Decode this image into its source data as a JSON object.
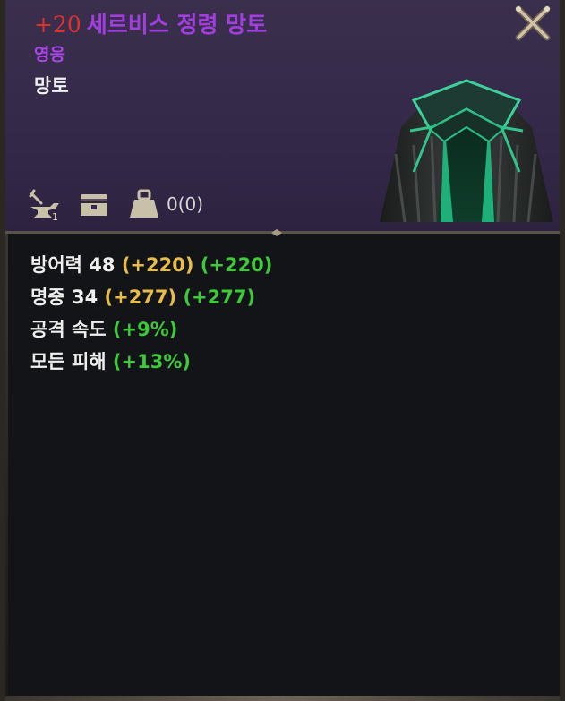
{
  "item": {
    "enchant": "+20",
    "name": "세르비스 정령 망토",
    "grade": "영웅",
    "type": "망토",
    "weight_text": "0(0)"
  },
  "icons": {
    "close": "close-x-icon",
    "blacksmith": "anvil-hammer-icon",
    "storage": "chest-icon",
    "weight": "weight-icon"
  },
  "stats": [
    {
      "label": "방어력 48",
      "bonus1": "(+220)",
      "bonus2": "(+220)"
    },
    {
      "label": "명중 34",
      "bonus1": "(+277)",
      "bonus2": "(+277)"
    },
    {
      "label": "공격 속도",
      "bonus2": "(+9%)"
    },
    {
      "label": "모든 피해",
      "bonus2": "(+13%)"
    }
  ],
  "colors": {
    "enchant": "#e0312d",
    "name": "#a23ee0",
    "grade": "#a845e6",
    "bonus_yellow": "#e7bd47",
    "bonus_green": "#3ec93a",
    "header_bg": "#35294a"
  }
}
